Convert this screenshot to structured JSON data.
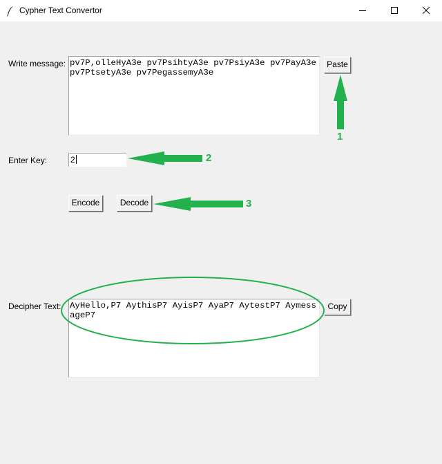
{
  "window": {
    "title": "Cypher Text Convertor",
    "controls": [
      "minimize",
      "maximize",
      "close"
    ]
  },
  "input_section": {
    "label": "Write message:",
    "value": "pv7P,olleHyA3e pv7PsihtyA3e pv7PsiyA3e pv7PayA3e pv7PtsetyA3e pv7PegassemyA3e",
    "paste_button": "Paste"
  },
  "key_section": {
    "label": "Enter Key:",
    "value": "2"
  },
  "actions": {
    "encode_button": "Encode",
    "decode_button": "Decode"
  },
  "output_section": {
    "label": "Decipher Text:",
    "value": "AyHello,P7 AythisP7 AyisP7 AyaP7 AytestP7 AymessageP7",
    "copy_button": "Copy"
  },
  "annotations": {
    "step_labels": [
      "1",
      "2",
      "3"
    ],
    "accent_color": "#22b14c"
  }
}
